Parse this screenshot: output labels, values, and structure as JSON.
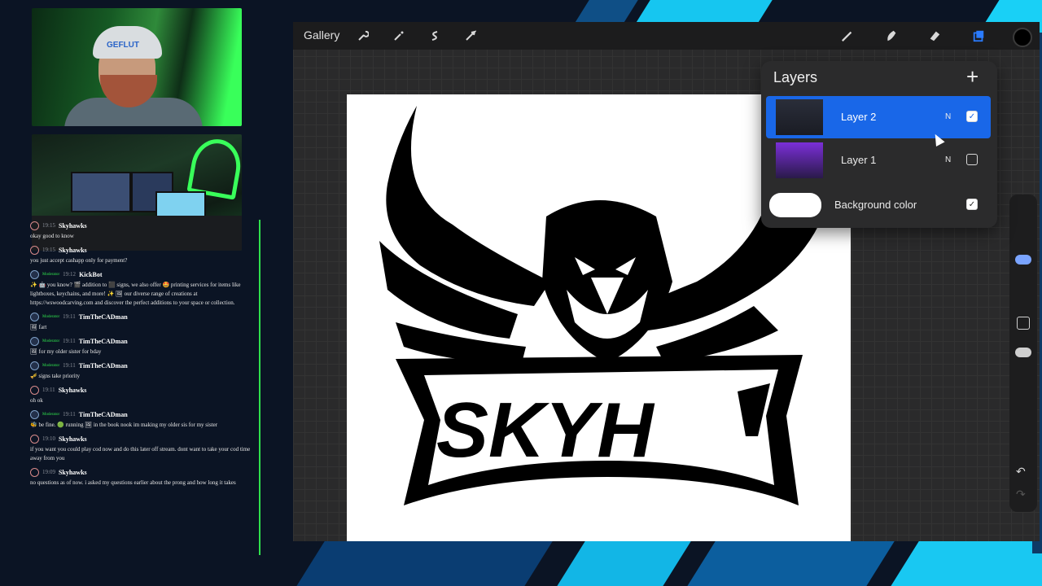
{
  "toolbar": {
    "gallery_label": "Gallery",
    "tools": [
      {
        "name": "wrench-icon"
      },
      {
        "name": "magic-wand-icon"
      },
      {
        "name": "selection-icon"
      },
      {
        "name": "transform-icon"
      },
      {
        "name": "brush-icon"
      },
      {
        "name": "smudge-icon"
      },
      {
        "name": "eraser-icon"
      },
      {
        "name": "layers-icon"
      }
    ],
    "current_color": "#000000"
  },
  "layers_panel": {
    "title": "Layers",
    "add_icon": "plus-icon",
    "layers": [
      {
        "name": "Layer 2",
        "blend": "N",
        "visible": true,
        "active": true
      },
      {
        "name": "Layer 1",
        "blend": "N",
        "visible": false,
        "active": false
      }
    ],
    "background": {
      "name": "Background color",
      "visible": true
    }
  },
  "artwork": {
    "text": "SKYH"
  },
  "webcam": {
    "cap_text": "GEFLUT"
  },
  "chat": [
    {
      "time": "19:15",
      "user": "Skyhawks",
      "moderator": false,
      "text": "okay good to know"
    },
    {
      "time": "19:15",
      "user": "Skyhawks",
      "moderator": false,
      "text": "you just accept cashapp only for payment?"
    },
    {
      "time": "19:12",
      "user": "KickBot",
      "moderator": true,
      "text": "✨ 🤖 you know? 🎬 addition to ⬛ signs, we also offer 🤩 printing services for items like lightboxes, keychains, and more! ✨ 🖼 our diverse range of creations at https://wswoodcarving.com and discover the perfect additions to your space or collection."
    },
    {
      "time": "19:11",
      "user": "TimTheCADman",
      "moderator": true,
      "text": "🖼 fart"
    },
    {
      "time": "19:11",
      "user": "TimTheCADman",
      "moderator": true,
      "text": "🖼 for my older sister for bday"
    },
    {
      "time": "19:11",
      "user": "TimTheCADman",
      "moderator": true,
      "text": "🎺 signs take priority"
    },
    {
      "time": "19:11",
      "user": "Skyhawks",
      "moderator": false,
      "text": "oh ok"
    },
    {
      "time": "19:11",
      "user": "TimTheCADman",
      "moderator": true,
      "text": "🐝 be fine. 🟢 running 🖼 in the book nook im making my older sis for my sister"
    },
    {
      "time": "19:10",
      "user": "Skyhawks",
      "moderator": false,
      "text": "if you want you could play cod now and do this later off stream. dont want to take your cod time away from you"
    },
    {
      "time": "19:09",
      "user": "Skyhawks",
      "moderator": false,
      "text": "no questions as of now. i asked my questions earlier about the prong and how long it takes"
    }
  ],
  "moderator_badge": "Moderator"
}
